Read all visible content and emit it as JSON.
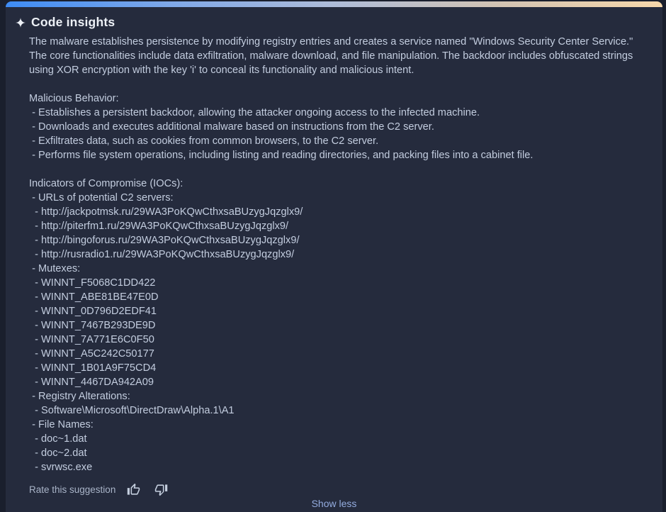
{
  "header": {
    "title": "Code insights",
    "icon": "sparkle-icon"
  },
  "insight": {
    "body": "The malware establishes persistence by modifying registry entries and creates a service named \"Windows Security Center Service.\" The core functionalities include data exfiltration, malware download, and file manipulation. The backdoor includes obfuscated strings using XOR encryption with the key 'i' to conceal its functionality and malicious intent.\n\nMalicious Behavior:\n - Establishes a persistent backdoor, allowing the attacker ongoing access to the infected machine.\n - Downloads and executes additional malware based on instructions from the C2 server.\n - Exfiltrates data, such as cookies from common browsers, to the C2 server.\n - Performs file system operations, including listing and reading directories, and packing files into a cabinet file.\n\nIndicators of Compromise (IOCs):\n - URLs of potential C2 servers:\n  - http://jackpotmsk.ru/29WA3PoKQwCthxsaBUzygJqzglx9/\n  - http://piterfm1.ru/29WA3PoKQwCthxsaBUzygJqzglx9/\n  - http://bingoforus.ru/29WA3PoKQwCthxsaBUzygJqzglx9/\n  - http://rusradio1.ru/29WA3PoKQwCthxsaBUzygJqzglx9/\n - Mutexes:\n  - WINNT_F5068C1DD422\n  - WINNT_ABE81BE47E0D\n  - WINNT_0D796D2EDF41\n  - WINNT_7467B293DE9D\n  - WINNT_7A771E6C0F50\n  - WINNT_A5C242C50177\n  - WINNT_1B01A9F75CD4\n  - WINNT_4467DA942A09\n - Registry Alterations:\n  - Software\\Microsoft\\DirectDraw\\Alpha.1\\A1\n - File Names:\n  - doc~1.dat\n  - doc~2.dat\n  - svrwsc.exe"
  },
  "footer": {
    "rate_label": "Rate this suggestion",
    "thumbs_up_icon": "thumbs-up-icon",
    "thumbs_down_icon": "thumbs-down-icon",
    "show_less_label": "Show less"
  },
  "colors": {
    "page_bg": "#1A1F2D",
    "card_bg": "#252B3D",
    "title_text": "#ECF0F6",
    "body_text": "#C3CDDF",
    "muted_text": "#A9B4C8",
    "link_text": "#94ACDF",
    "accent_gradient": [
      "#3E8CF5",
      "#7FA8E8",
      "#AEBCD9",
      "#D2C3B3",
      "#F7D8AB"
    ]
  }
}
